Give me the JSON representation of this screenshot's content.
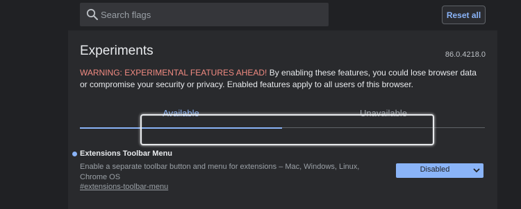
{
  "search": {
    "placeholder": "Search flags",
    "value": ""
  },
  "header": {
    "reset_label": "Reset all"
  },
  "main": {
    "title": "Experiments",
    "version": "86.0.4218.0",
    "warning_label": "WARNING: EXPERIMENTAL FEATURES AHEAD!",
    "warning_text": " By enabling these features, you could lose browser data or compromise your security or privacy. Enabled features apply to all users of this browser.",
    "tabs": [
      {
        "label": "Available",
        "active": true
      },
      {
        "label": "Unavailable",
        "active": false
      }
    ]
  },
  "experiment": {
    "title": "Extensions Toolbar Menu",
    "description": "Enable a separate toolbar button and menu for extensions – Mac, Windows, Linux, Chrome OS",
    "link": "#extensions-toolbar-menu",
    "selected_option": "Disabled"
  },
  "colors": {
    "accent": "#8ab4f8",
    "warning": "#f28b82",
    "background": "#202124",
    "panel": "#292a2d"
  },
  "icons": {
    "search": "search-icon",
    "dropdown": "chevron-down-icon"
  }
}
